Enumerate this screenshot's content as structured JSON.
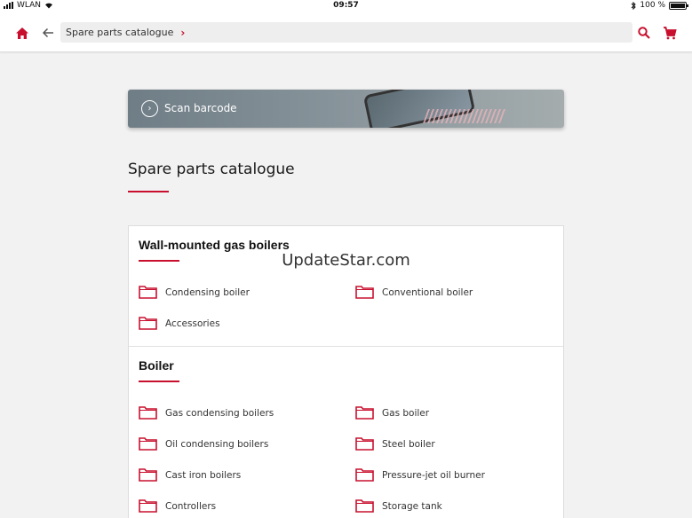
{
  "status": {
    "network": "WLAN",
    "time": "09:57",
    "battery": "100 %"
  },
  "nav": {
    "breadcrumb": "Spare parts catalogue"
  },
  "banner": {
    "label": "Scan barcode"
  },
  "page": {
    "title": "Spare parts catalogue"
  },
  "watermark": "UpdateStar.com",
  "sections": [
    {
      "title": "Wall-mounted gas boilers",
      "items": [
        "Condensing boiler",
        "Conventional boiler",
        "Accessories"
      ]
    },
    {
      "title": "Boiler",
      "items": [
        "Gas condensing boilers",
        "Gas boiler",
        "Oil condensing boilers",
        "Steel boiler",
        "Cast iron boilers",
        "Pressure-jet oil burner",
        "Controllers",
        "Storage tank"
      ]
    }
  ],
  "colors": {
    "accent": "#c8102e",
    "background": "#f2f2f2"
  }
}
